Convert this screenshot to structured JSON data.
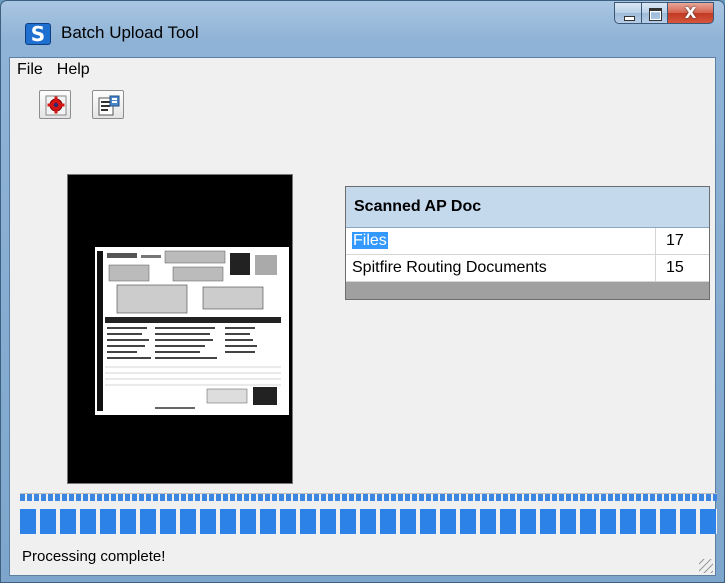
{
  "window": {
    "title": "Batch Upload Tool",
    "icon": "S",
    "close_glyph": "X"
  },
  "menu": {
    "items": [
      "File",
      "Help"
    ]
  },
  "toolbar": {
    "buttons": [
      "settings-gear-icon",
      "properties-form-icon"
    ]
  },
  "grid": {
    "header": "Scanned AP Doc",
    "rows": [
      {
        "name": "Files",
        "count": "17",
        "selected": true
      },
      {
        "name": "Spitfire Routing Documents",
        "count": "15",
        "selected": false
      }
    ]
  },
  "progress": {
    "value": 1.0
  },
  "status": {
    "text": "Processing complete!"
  },
  "colors": {
    "progress": "#2c82e6",
    "selection": "#3399ff",
    "grid_header": "#c5d9ed"
  }
}
